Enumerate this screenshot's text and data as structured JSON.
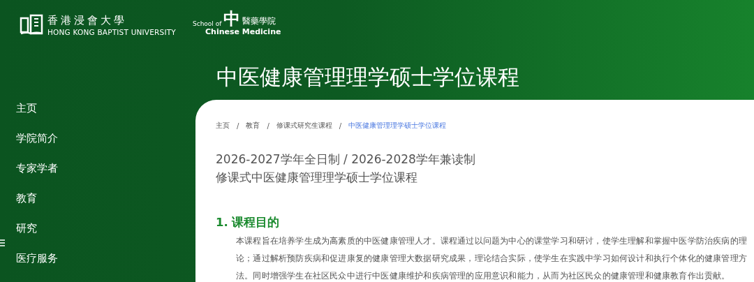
{
  "header": {
    "university": {
      "chinese": "香港浸會大學",
      "english": "HONG KONG BAPTIST UNIVERSITY"
    },
    "school": {
      "prefix": "School of",
      "chinese_first": "中",
      "chinese_rest": "醫藥學院",
      "english": "Chinese Medicine"
    }
  },
  "page_title": "中医健康管理理学硕士学位课程",
  "sidebar": {
    "items": [
      {
        "label": "主页",
        "selected": false
      },
      {
        "label": "学院简介",
        "selected": false
      },
      {
        "label": "专家学者",
        "selected": false
      },
      {
        "label": "教育",
        "selected": false
      },
      {
        "label": "研究",
        "selected": false
      },
      {
        "label": "医疗服务",
        "selected": false
      }
    ]
  },
  "breadcrumb": [
    {
      "label": "主页",
      "current": false
    },
    {
      "label": "教育",
      "current": false
    },
    {
      "label": "修课式研究生课程",
      "current": false
    },
    {
      "label": "中医健康管理理学硕士学位课程",
      "current": true
    }
  ],
  "breadcrumb_separator": "/",
  "heading_lines": [
    "2026-2027学年全日制 / 2026-2028学年兼读制",
    "修课式中医健康管理理学硕士学位课程"
  ],
  "sections": [
    {
      "title": "1. 课程目的",
      "body": "本课程旨在培养学生成为高素质的中医健康管理人才。课程通过以问题为中心的课堂学习和研讨，使学生理解和掌握中医学防治疾病的理论；通过解析预防疾病和促进康复的健康管理大数据研究成果，理论结合实际，使学生在实践中学习如何设计和执行个体化的健康管理方法。同时增强学生在社区民众中进行中医健康维护和疾病管理的应用意识和能力，从而为社区民众的健康管理和健康教育作出贡献。"
    }
  ]
}
